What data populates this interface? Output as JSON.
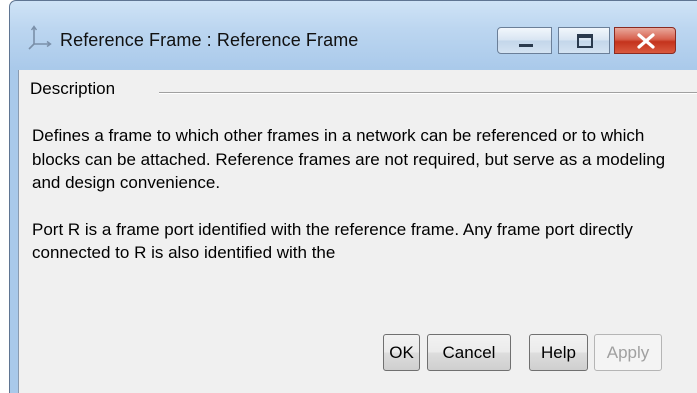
{
  "window": {
    "title": "Reference Frame : Reference  Frame",
    "icon": "reference-frame-axes-icon"
  },
  "caption_buttons": {
    "minimize_icon": "minimize-icon",
    "maximize_icon": "maximize-icon",
    "close_icon": "close-icon",
    "close_color": "#c4331d"
  },
  "description": {
    "legend": "Description",
    "paragraphs": [
      "Defines a frame to which other frames in a network can be referenced or to which blocks can be attached. Reference frames are not required, but serve as a modeling and design convenience.",
      "Port R is a frame port identified with the reference frame. Any frame port directly connected to R is also identified with the"
    ]
  },
  "buttons": {
    "ok": "OK",
    "cancel": "Cancel",
    "help": "Help",
    "apply": "Apply"
  }
}
